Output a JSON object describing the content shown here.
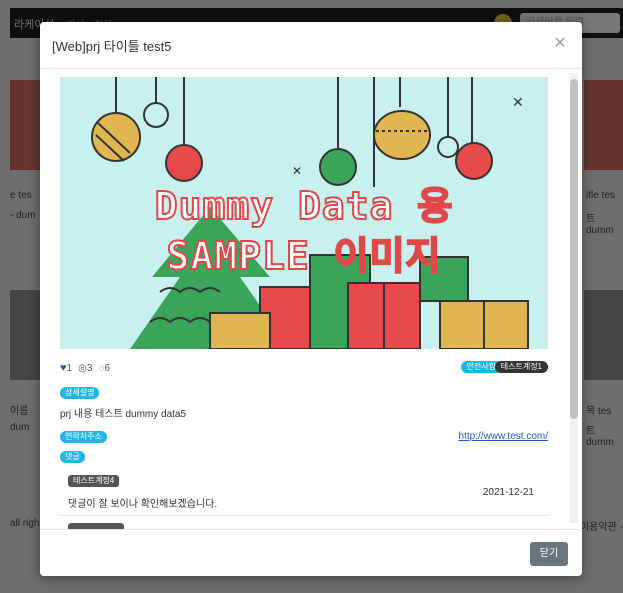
{
  "background": {
    "logo": "라케이션",
    "menu": [
      "게시",
      "질문"
    ],
    "search_placeholder": "검색어를 입력",
    "side_texts": {
      "left_title": "e tes",
      "left_sub": "- dum",
      "right_title": "itle tes",
      "right_sub": "트 dumm",
      "left_title2": "이름",
      "left_sub2": "dum",
      "right_title2": "목 tes",
      "right_sub2": "트 dumm",
      "footer_left": "all righ",
      "footer_right": "이용약관 · 이"
    }
  },
  "modal": {
    "title": "[Web]prj 타이틀 test5",
    "close_symbol": "×",
    "hero": {
      "line1": "Dummy Data 용",
      "line2": "SAMPLE 이미지"
    },
    "stats": {
      "likes": "1",
      "views": "3",
      "comments": "6"
    },
    "tags": [
      "안전사항",
      "테스트계정1"
    ],
    "section_content_label": "상세설명",
    "content_text": "prj 내용 테스트 dummy data5",
    "section_link_label": "연락처주소",
    "link_text": "http://www.test.com/",
    "section_comment_label": "댓글",
    "comments": [
      {
        "author": "테스트계정4",
        "text": "댓글이 잘 보이나 확인해보겠습니다.",
        "date": "2021-12-21"
      }
    ],
    "footer_button": "닫기"
  },
  "colors": {
    "accent_cyan": "#1fb6e6",
    "hero_bg": "#c7f0ee",
    "hero_text_stroke": "#e04848",
    "close_button": "#6c757d"
  }
}
